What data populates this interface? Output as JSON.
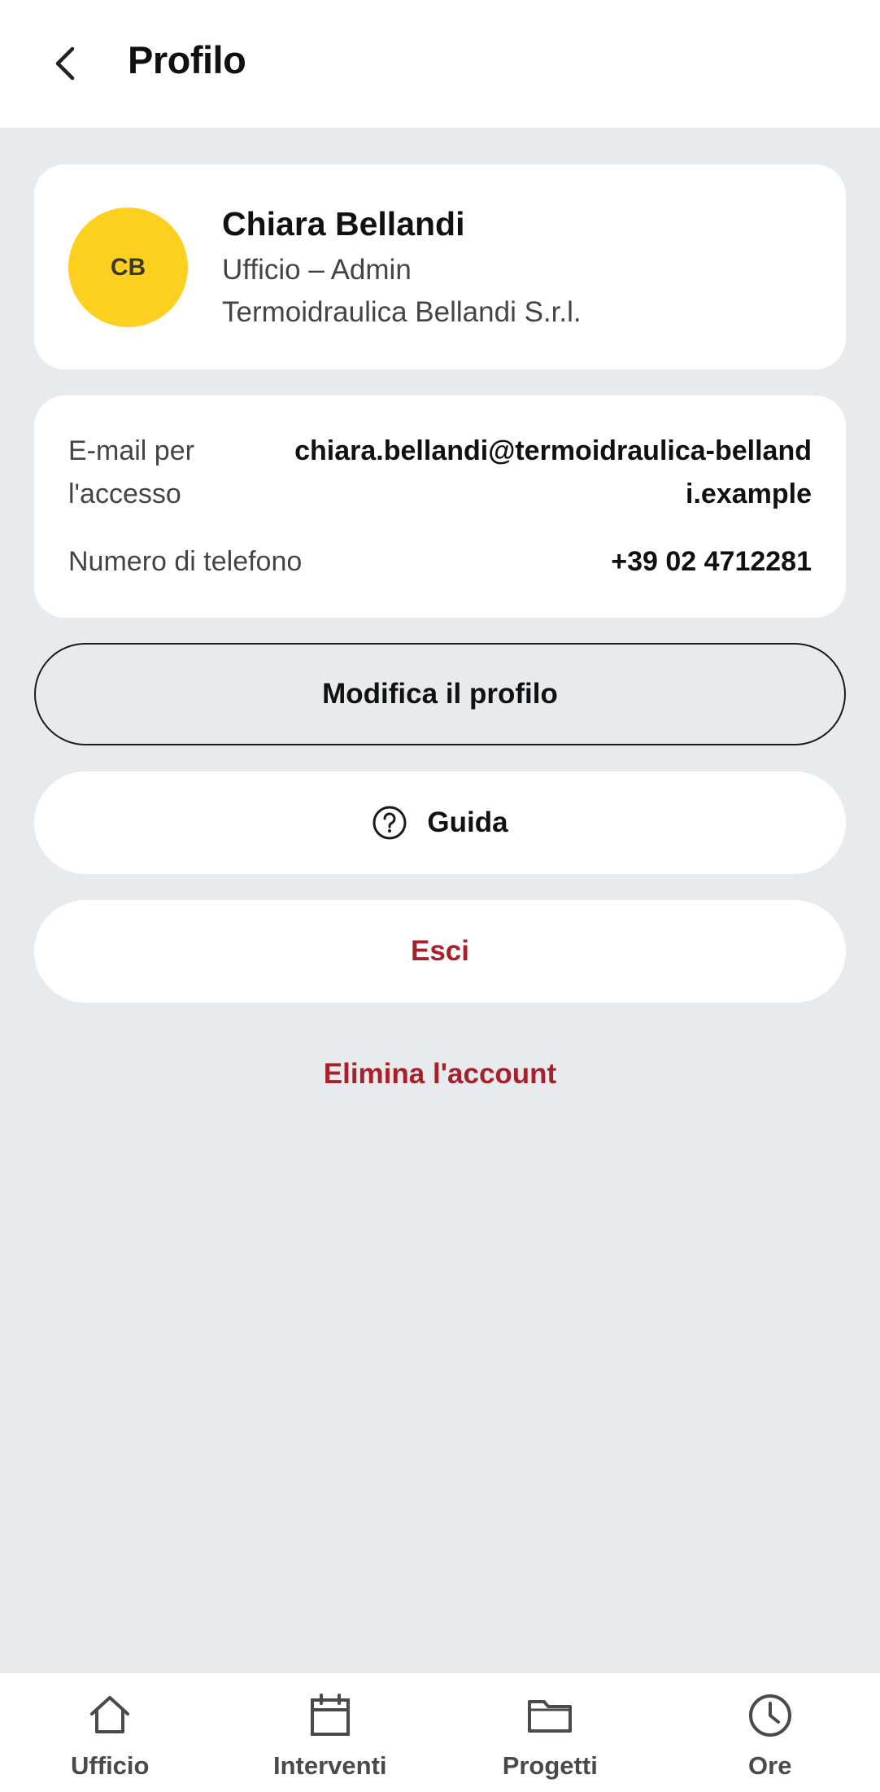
{
  "header": {
    "title": "Profilo",
    "back_icon": "chevron-left-icon"
  },
  "profile": {
    "initials": "CB",
    "avatar_color": "#fdd020",
    "name": "Chiara Bellandi",
    "role": "Ufficio – Admin",
    "company": "Termoidraulica Bellandi S.r.l."
  },
  "info": {
    "email_label": "E-mail per l'accesso",
    "email_value": "chiara.bellandi@termoidraulica-bellandi.example",
    "phone_label": "Numero di telefono",
    "phone_value": "+39 02 4712281"
  },
  "actions": {
    "edit_label": "Modifica il profilo",
    "help_label": "Guida",
    "help_icon": "help-circle-icon",
    "logout_label": "Esci",
    "delete_label": "Elimina l'account",
    "danger_color": "#a8202a"
  },
  "nav": {
    "items": [
      {
        "label": "Ufficio",
        "icon": "home-icon"
      },
      {
        "label": "Interventi",
        "icon": "calendar-icon"
      },
      {
        "label": "Progetti",
        "icon": "folder-icon"
      },
      {
        "label": "Ore",
        "icon": "clock-icon"
      }
    ]
  }
}
